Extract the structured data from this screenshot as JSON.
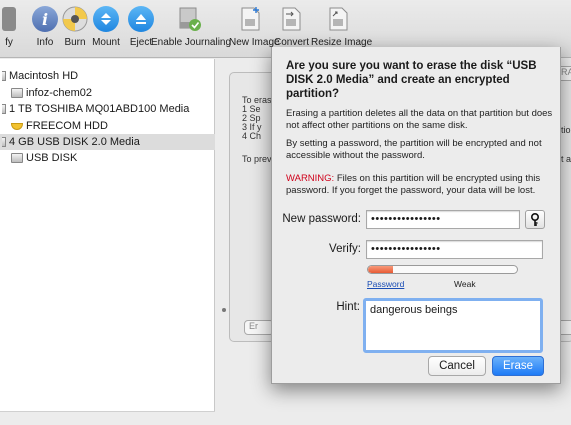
{
  "toolbar": {
    "items": [
      {
        "label": "fy",
        "icon": "verify-icon"
      },
      {
        "label": "Info",
        "icon": "info-icon"
      },
      {
        "label": "Burn",
        "icon": "burn-icon"
      },
      {
        "label": "Mount",
        "icon": "mount-icon"
      },
      {
        "label": "Eject",
        "icon": "eject-icon"
      },
      {
        "label": "Enable Journaling",
        "icon": "journaling-icon"
      },
      {
        "label": "New Image",
        "icon": "new-image-icon"
      },
      {
        "label": "Convert",
        "icon": "convert-icon"
      },
      {
        "label": "Resize Image",
        "icon": "resize-image-icon"
      }
    ]
  },
  "sidebar": {
    "items": [
      {
        "label": "Macintosh HD",
        "selected": false
      },
      {
        "label": "infoz-chem02",
        "selected": false
      },
      {
        "label": "1 TB TOSHIBA MQ01ABD100 Media",
        "selected": false
      },
      {
        "label": "FREECOM HDD",
        "selected": false
      },
      {
        "label": "4 GB USB DISK 2.0 Media",
        "selected": true
      },
      {
        "label": "USB DISK",
        "selected": false
      }
    ]
  },
  "background": {
    "lines": [
      "To erase",
      "1   Se",
      "2   Sp",
      "3   If y",
      "4   Ch",
      "To prev"
    ],
    "right_fragments": [
      "RA",
      "tion",
      "t a v"
    ],
    "erase_button_fragment": "Er"
  },
  "sheet": {
    "title": "Are you sure you want to erase the disk “USB DISK 2.0 Media” and create an encrypted partition?",
    "para1": "Erasing a partition deletes all the data on that partition but does not affect other partitions on the same disk.",
    "para2": "By setting a password, the partition will be encrypted and not accessible without the password.",
    "warning_label": "WARNING:",
    "warning_text": " Files on this partition will be encrypted using this password. If you forget the password, your data will be lost.",
    "new_password_label": "New password:",
    "new_password_value": "••••••••••••••••",
    "verify_label": "Verify:",
    "verify_value": "••••••••••••••••",
    "strength_fraction": 0.17,
    "password_link": "Password",
    "strength_text": "Weak",
    "hint_label": "Hint:",
    "hint_value": "dangerous beings",
    "cancel_label": "Cancel",
    "erase_label": "Erase"
  },
  "colors": {
    "accent": "#1d7af6",
    "warning": "#d0021b",
    "meter": "#e85a34",
    "focus_ring": "#7fb0f0"
  }
}
